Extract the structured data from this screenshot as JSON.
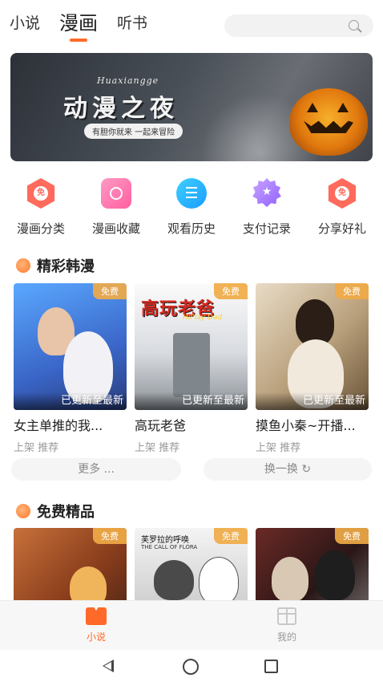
{
  "top_tabs": [
    {
      "label": "小说"
    },
    {
      "label": "漫画"
    },
    {
      "label": "听书"
    }
  ],
  "banner": {
    "subtitle": "Huaxiangge",
    "title": "动漫之夜",
    "tagline": "有胆你就来 一起来冒险"
  },
  "shortcuts": [
    {
      "label": "漫画分类",
      "icon": "coupon-hex-icon",
      "icon_text": "免"
    },
    {
      "label": "漫画收藏",
      "icon": "favorites-icon"
    },
    {
      "label": "观看历史",
      "icon": "history-list-icon"
    },
    {
      "label": "支付记录",
      "icon": "payment-badge-icon"
    },
    {
      "label": "分享好礼",
      "icon": "share-gift-icon",
      "icon_text": "免"
    }
  ],
  "sections": {
    "korean": {
      "title": "精彩韩漫",
      "cards": [
        {
          "title": "女主单推的我...",
          "meta": "上架 推荐",
          "badge": "免费",
          "status": "已更新至最新"
        },
        {
          "title": "高玩老爸",
          "meta": "上架 推荐",
          "badge": "免费",
          "status": "已更新至最新",
          "cover_title": "高玩老爸",
          "cover_subtitle": "HiPlay Dad"
        },
        {
          "title": "摸鱼小秦~开播...",
          "meta": "上架 推荐",
          "badge": "免费",
          "status": "已更新至最新"
        }
      ],
      "more_label": "更多 ...",
      "refresh_label": "换一换 ↻"
    },
    "free": {
      "title": "免费精品",
      "cards": [
        {
          "badge": "免费"
        },
        {
          "badge": "免费",
          "cover_title": "芙罗拉的呼唤",
          "cover_subtitle": "THE CALL OF FLORA"
        },
        {
          "badge": "免费"
        }
      ]
    }
  },
  "tabbar": {
    "items": [
      {
        "label": "小说",
        "active": true
      },
      {
        "label": "我的",
        "active": false
      }
    ]
  },
  "colors": {
    "accent": "#ff6a2a",
    "badge": "#f0aa46"
  }
}
